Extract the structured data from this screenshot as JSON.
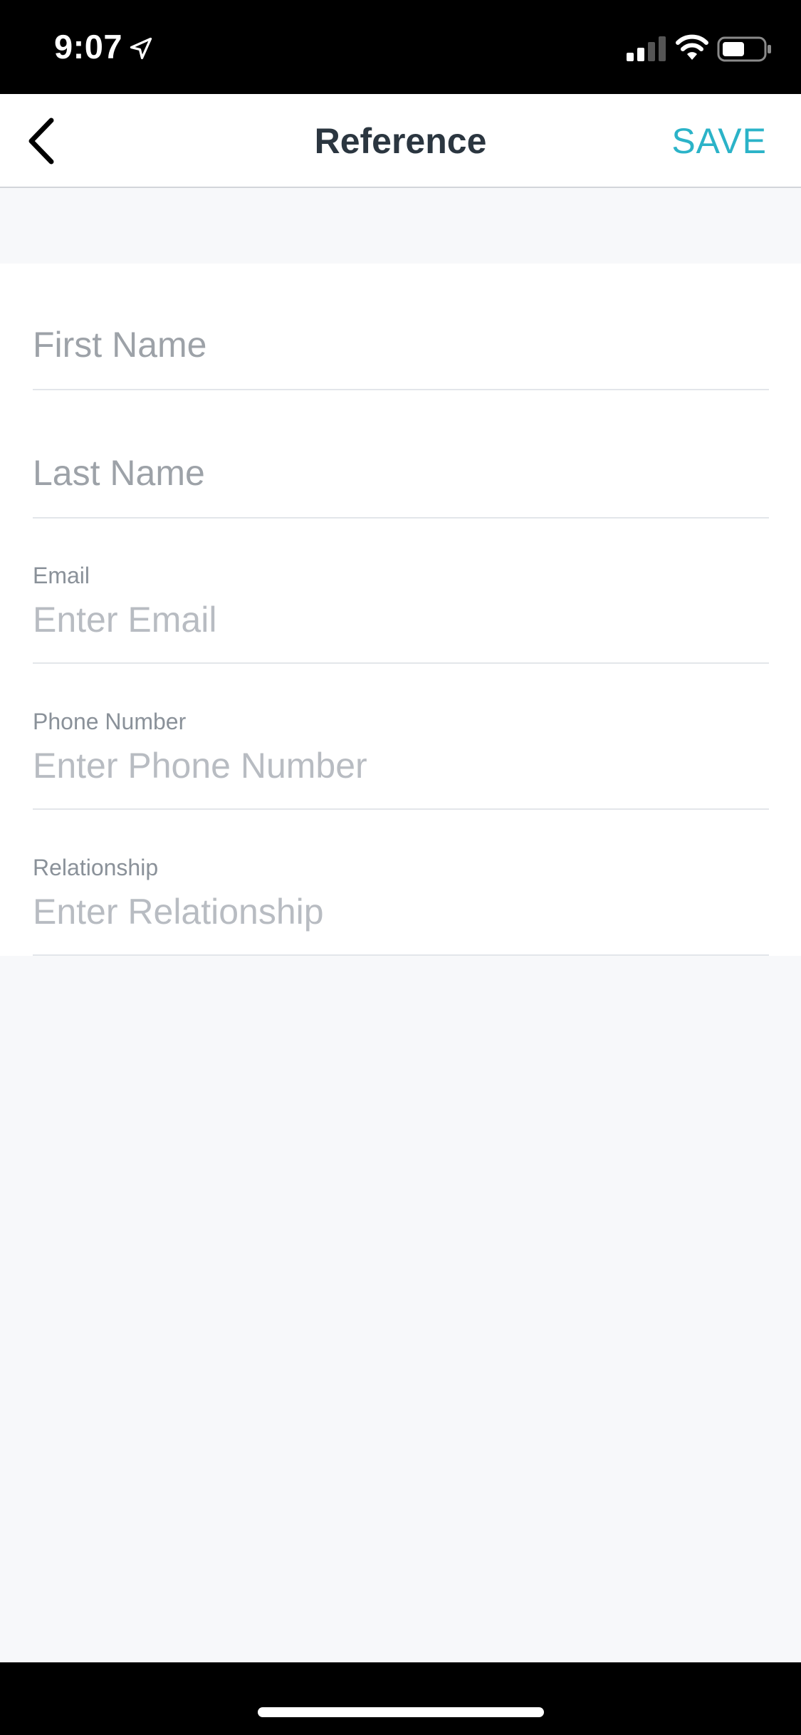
{
  "status_bar": {
    "time": "9:07"
  },
  "nav": {
    "title": "Reference",
    "save_label": "SAVE"
  },
  "form": {
    "first_name": {
      "placeholder": "First Name"
    },
    "last_name": {
      "placeholder": "Last Name"
    },
    "email": {
      "label": "Email",
      "placeholder": "Enter Email"
    },
    "phone": {
      "label": "Phone Number",
      "placeholder": "Enter Phone Number"
    },
    "relationship": {
      "label": "Relationship",
      "placeholder": "Enter Relationship"
    }
  },
  "colors": {
    "accent": "#2bb3c8",
    "title": "#2b3640",
    "background": "#f7f8fa"
  }
}
